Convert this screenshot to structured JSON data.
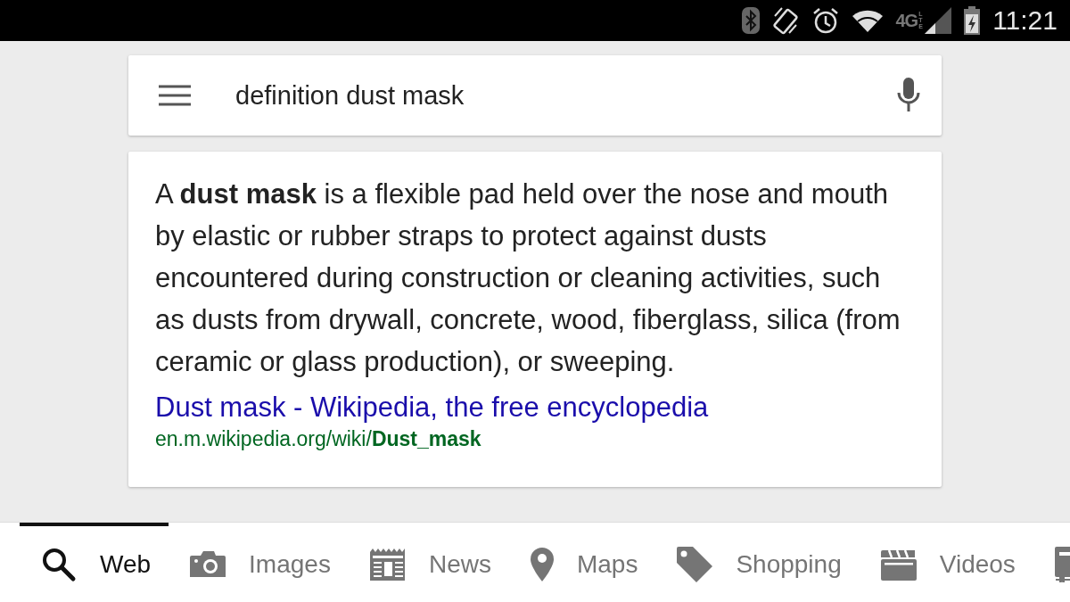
{
  "status_bar": {
    "network": "4G",
    "network_sub": "LTE",
    "time": "11:21"
  },
  "search": {
    "query": "definition dust mask"
  },
  "result": {
    "definition": "A **dust mask** is a flexible pad held over the nose and mouth by elastic or rubber straps to protect against dusts encountered during construction or cleaning activities, such as dusts from drywall, concrete, wood, fiberglass, silica (from ceramic or glass production), or sweeping.",
    "link": "Dust mask - Wikipedia, the free encyclopedia",
    "url": "en.m.wikipedia.org/wiki/**Dust_mask**"
  },
  "tabs": [
    {
      "kind": "web",
      "label": "Web",
      "selected": true
    },
    {
      "kind": "images",
      "label": "Images",
      "selected": false
    },
    {
      "kind": "news",
      "label": "News",
      "selected": false
    },
    {
      "kind": "maps",
      "label": "Maps",
      "selected": false
    },
    {
      "kind": "shopping",
      "label": "Shopping",
      "selected": false
    },
    {
      "kind": "videos",
      "label": "Videos",
      "selected": false
    },
    {
      "kind": "books",
      "selected": false
    }
  ]
}
